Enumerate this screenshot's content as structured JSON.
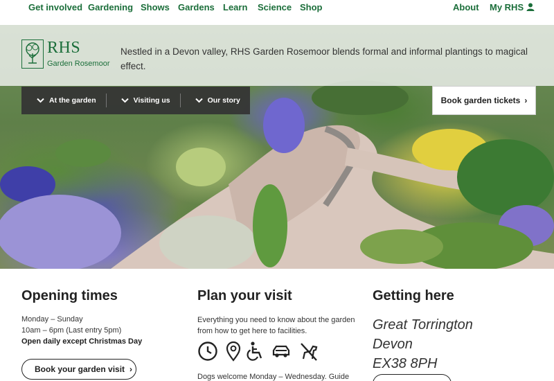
{
  "top_nav": {
    "items": [
      "Get involved",
      "Gardening",
      "Shows",
      "Gardens",
      "Learn",
      "Science",
      "Shop"
    ],
    "about": "About",
    "my_rhs": "My RHS"
  },
  "logo": {
    "rhs": "RHS",
    "sub": "Garden Rosemoor"
  },
  "intro": "Nestled in a Devon valley, RHS Garden Rosemoor blends formal and informal plantings to magical effect.",
  "sub_nav": {
    "tabs": [
      "At the garden",
      "Visiting us",
      "Our story"
    ]
  },
  "book_tickets": "Book garden tickets",
  "opening": {
    "title": "Opening times",
    "days": "Monday – Sunday",
    "hours": "10am – 6pm (Last entry 5pm)",
    "note": "Open daily except Christmas Day",
    "button": "Book your garden visit"
  },
  "plan": {
    "title": "Plan your visit",
    "desc": "Everything you need to know about the garden from how to get here to facilities.",
    "icons": [
      "clock-icon",
      "map-pin-icon",
      "wheelchair-icon",
      "car-icon",
      "no-dogs-icon"
    ],
    "dogs": "Dogs welcome Monday – Wednesday. Guide"
  },
  "getting": {
    "title": "Getting here",
    "address": [
      "Great Torrington",
      "Devon",
      "EX38 8PH"
    ]
  },
  "colors": {
    "brand_green": "#1b6e3a",
    "subnav_bg": "#333333"
  }
}
